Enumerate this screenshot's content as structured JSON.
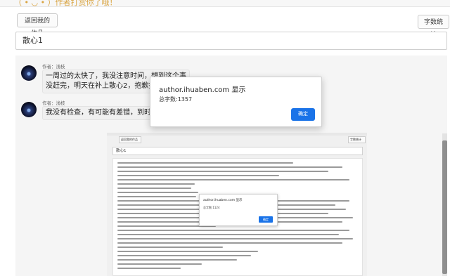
{
  "topbar": {
    "note": "（ • ◡ • ）作者打赏你了哦！"
  },
  "toolbar": {
    "back_label": "返回我的作品",
    "stats_label": "字数统计"
  },
  "chapter": {
    "title": "散心1"
  },
  "comments": [
    {
      "author": "作者：浅枝",
      "text_line1": "一周过的太快了，我没注意时间，想到这个事",
      "text_line2": "没赶完，明天在补上散心2，抱歉抱歉"
    },
    {
      "author": "作者：浅枝",
      "text_line1": "我没有检查，有可能有差错，到时候在改"
    }
  ],
  "dialog": {
    "title": "author.ihuaben.com 显示",
    "message": "总字数:1357",
    "ok_label": "确定"
  },
  "embedded_screenshot": {
    "back_label": "返回我的作品",
    "stats_label": "字数统计",
    "title": "散心1",
    "dialog_title": "author.ihuaben.com 显示",
    "dialog_message": "总字数:1124",
    "dialog_ok": "确定"
  }
}
